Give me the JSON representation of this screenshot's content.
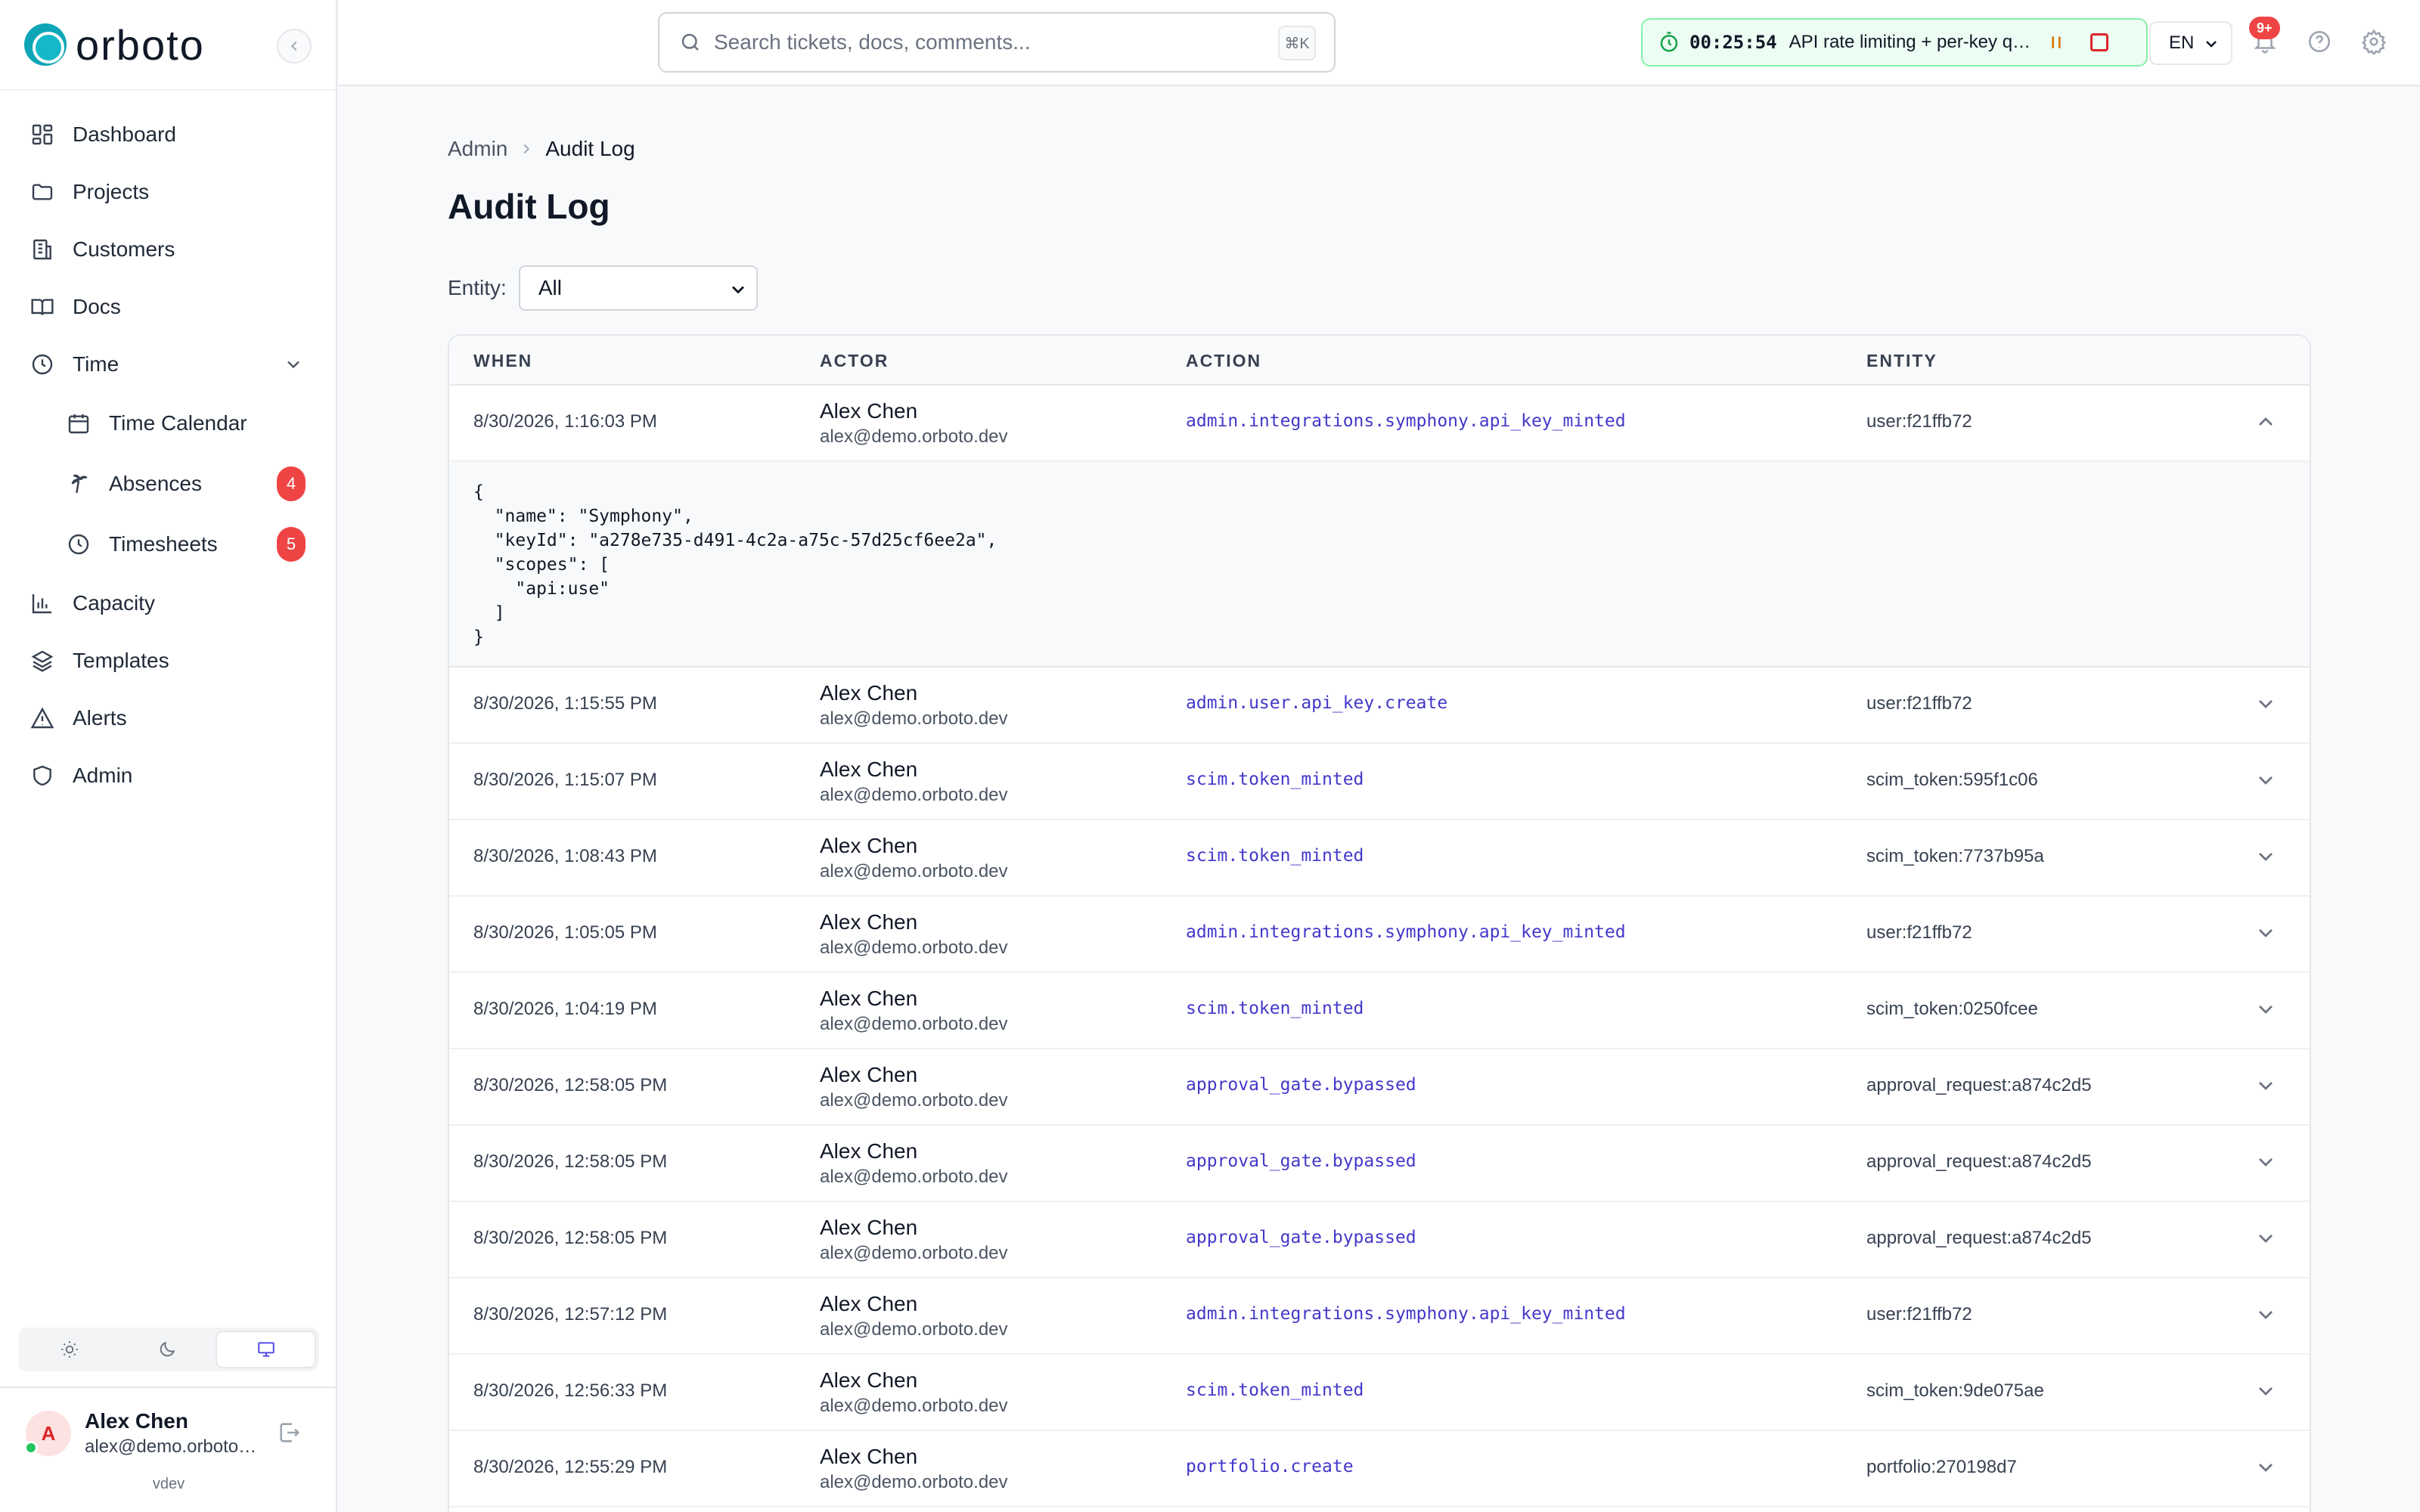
{
  "app": {
    "logo_text": "orboto",
    "env": "vdev"
  },
  "sidebar": {
    "items": [
      {
        "label": "Dashboard",
        "icon": "dashboard-icon"
      },
      {
        "label": "Projects",
        "icon": "folder-icon"
      },
      {
        "label": "Customers",
        "icon": "building-icon"
      },
      {
        "label": "Docs",
        "icon": "book-icon"
      },
      {
        "label": "Time",
        "icon": "clock-icon",
        "expanded": true
      },
      {
        "label": "Time Calendar",
        "icon": "calendar-icon"
      },
      {
        "label": "Absences",
        "icon": "palm-tree-icon",
        "badge": "4"
      },
      {
        "label": "Timesheets",
        "icon": "clock-icon",
        "badge": "5"
      },
      {
        "label": "Capacity",
        "icon": "bar-chart-icon"
      },
      {
        "label": "Templates",
        "icon": "layers-icon"
      },
      {
        "label": "Alerts",
        "icon": "alert-triangle-icon"
      },
      {
        "label": "Admin",
        "icon": "shield-icon"
      }
    ],
    "theme": {
      "options": [
        "light",
        "dark",
        "system"
      ],
      "selected": "system"
    }
  },
  "user": {
    "initial": "A",
    "name": "Alex Chen",
    "email": "alex@demo.orboto.dev"
  },
  "topbar": {
    "search_placeholder": "Search tickets, docs, comments...",
    "shortcut": "⌘K",
    "timer": {
      "time": "00:25:54",
      "description": "API rate limiting + per-key quotas"
    },
    "language": "EN",
    "notifications_badge": "9+"
  },
  "page": {
    "breadcrumb": [
      "Admin",
      "Audit Log"
    ],
    "title": "Audit Log",
    "filter": {
      "label": "Entity:",
      "value": "All"
    },
    "table": {
      "columns": [
        "WHEN",
        "ACTOR",
        "ACTION",
        "ENTITY"
      ],
      "expanded_details": "{\n  \"name\": \"Symphony\",\n  \"keyId\": \"a278e735-d491-4c2a-a75c-57d25cf6ee2a\",\n  \"scopes\": [\n    \"api:use\"\n  ]\n}",
      "rows": [
        {
          "when": "8/30/2026, 1:16:03 PM",
          "actor_name": "Alex Chen",
          "actor_email": "alex@demo.orboto.dev",
          "action": "admin.integrations.symphony.api_key_minted",
          "entity": "user:f21ffb72",
          "expanded": true
        },
        {
          "when": "8/30/2026, 1:15:55 PM",
          "actor_name": "Alex Chen",
          "actor_email": "alex@demo.orboto.dev",
          "action": "admin.user.api_key.create",
          "entity": "user:f21ffb72"
        },
        {
          "when": "8/30/2026, 1:15:07 PM",
          "actor_name": "Alex Chen",
          "actor_email": "alex@demo.orboto.dev",
          "action": "scim.token_minted",
          "entity": "scim_token:595f1c06"
        },
        {
          "when": "8/30/2026, 1:08:43 PM",
          "actor_name": "Alex Chen",
          "actor_email": "alex@demo.orboto.dev",
          "action": "scim.token_minted",
          "entity": "scim_token:7737b95a"
        },
        {
          "when": "8/30/2026, 1:05:05 PM",
          "actor_name": "Alex Chen",
          "actor_email": "alex@demo.orboto.dev",
          "action": "admin.integrations.symphony.api_key_minted",
          "entity": "user:f21ffb72"
        },
        {
          "when": "8/30/2026, 1:04:19 PM",
          "actor_name": "Alex Chen",
          "actor_email": "alex@demo.orboto.dev",
          "action": "scim.token_minted",
          "entity": "scim_token:0250fcee"
        },
        {
          "when": "8/30/2026, 12:58:05 PM",
          "actor_name": "Alex Chen",
          "actor_email": "alex@demo.orboto.dev",
          "action": "approval_gate.bypassed",
          "entity": "approval_request:a874c2d5"
        },
        {
          "when": "8/30/2026, 12:58:05 PM",
          "actor_name": "Alex Chen",
          "actor_email": "alex@demo.orboto.dev",
          "action": "approval_gate.bypassed",
          "entity": "approval_request:a874c2d5"
        },
        {
          "when": "8/30/2026, 12:58:05 PM",
          "actor_name": "Alex Chen",
          "actor_email": "alex@demo.orboto.dev",
          "action": "approval_gate.bypassed",
          "entity": "approval_request:a874c2d5"
        },
        {
          "when": "8/30/2026, 12:57:12 PM",
          "actor_name": "Alex Chen",
          "actor_email": "alex@demo.orboto.dev",
          "action": "admin.integrations.symphony.api_key_minted",
          "entity": "user:f21ffb72"
        },
        {
          "when": "8/30/2026, 12:56:33 PM",
          "actor_name": "Alex Chen",
          "actor_email": "alex@demo.orboto.dev",
          "action": "scim.token_minted",
          "entity": "scim_token:9de075ae"
        },
        {
          "when": "8/30/2026, 12:55:29 PM",
          "actor_name": "Alex Chen",
          "actor_email": "alex@demo.orboto.dev",
          "action": "portfolio.create",
          "entity": "portfolio:270198d7"
        }
      ]
    }
  },
  "colors": {
    "accent": "#4338ca",
    "brand": "#0ea5b7",
    "badge": "#ef4444",
    "timer_bg": "#ecfdf3"
  }
}
